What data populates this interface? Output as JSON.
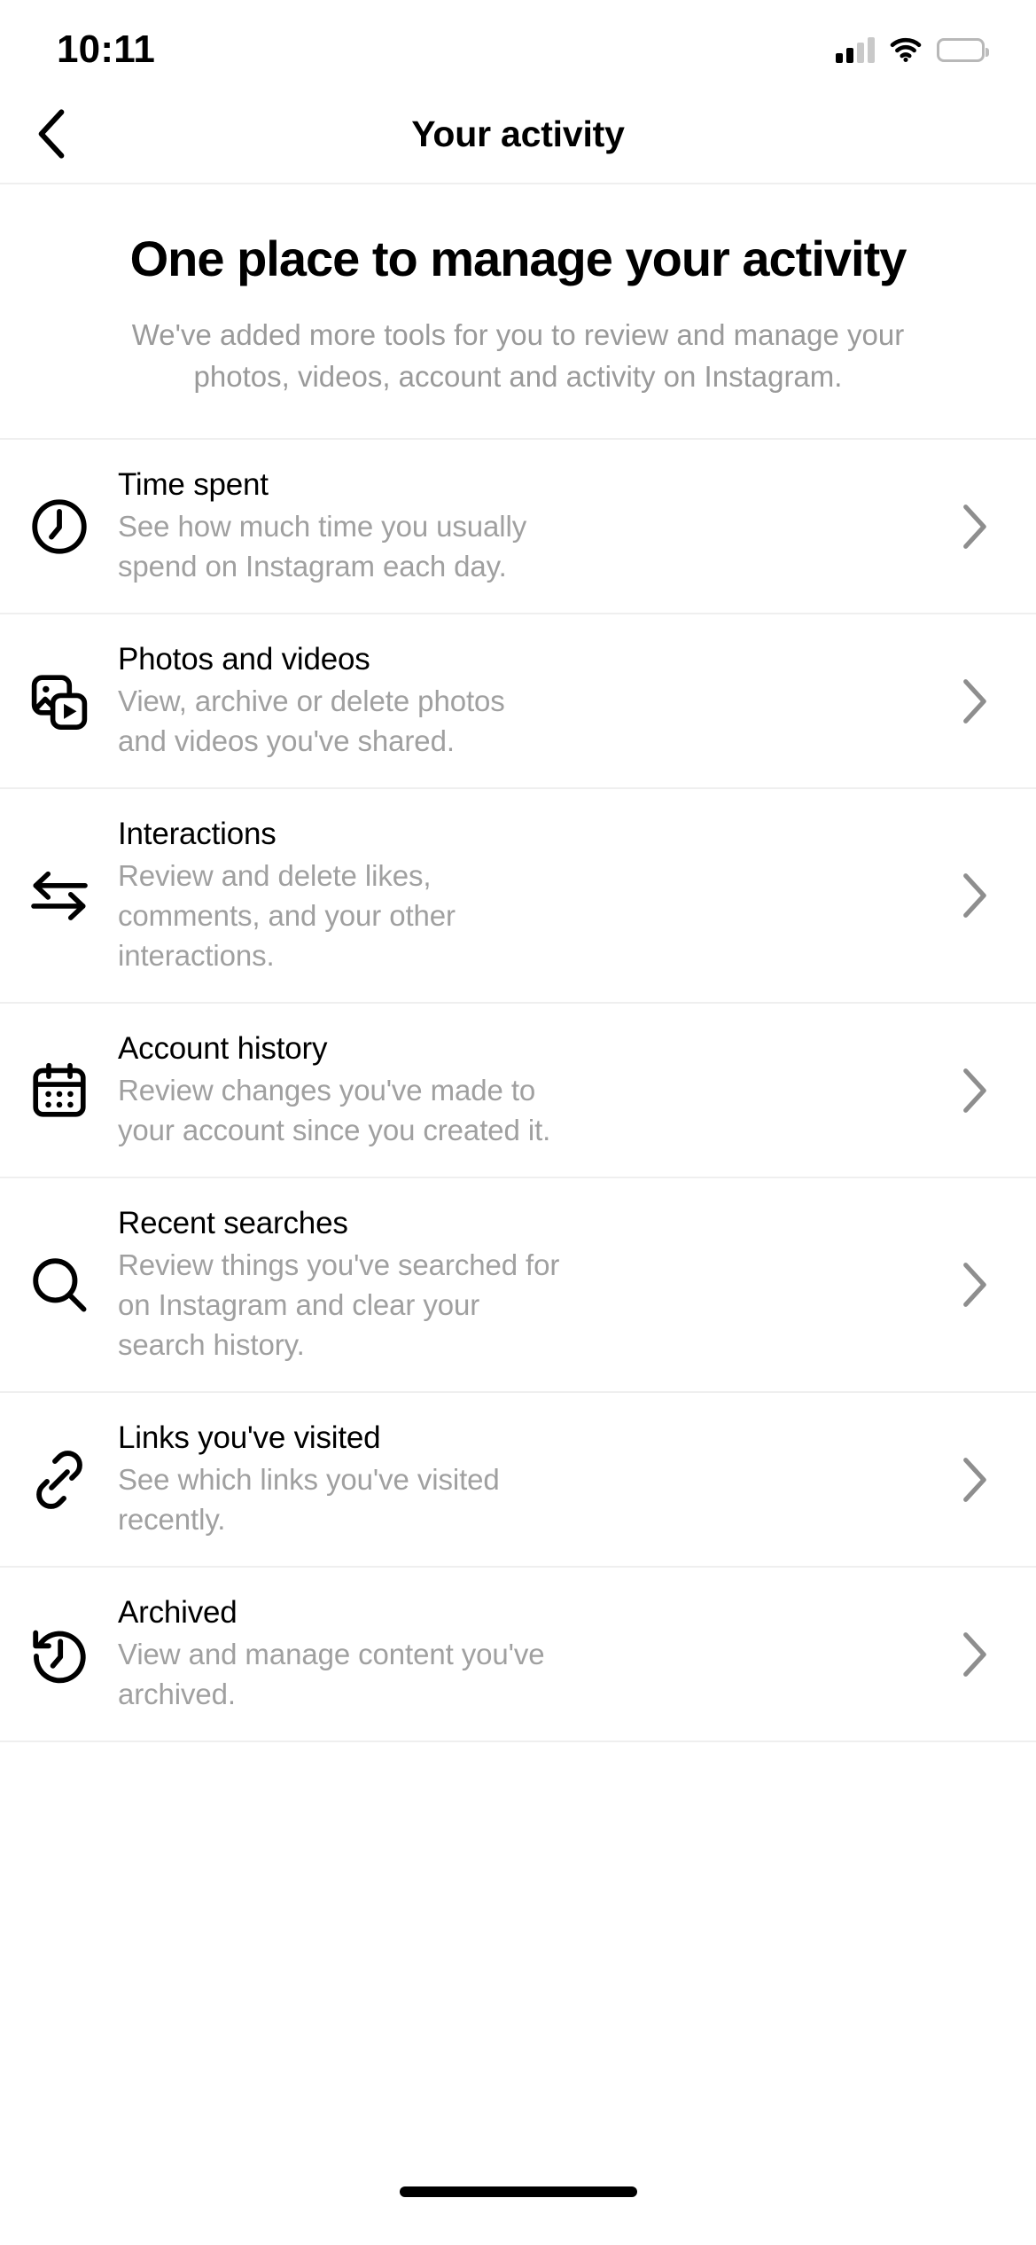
{
  "status_bar": {
    "time": "10:11",
    "cellular_icon": "cellular-signal-icon",
    "cellular_bars_filled": 2,
    "cellular_bars_total": 4,
    "wifi_icon": "wifi-icon",
    "battery_icon": "battery-full-icon"
  },
  "navbar": {
    "back_icon": "chevron-left-icon",
    "title": "Your activity"
  },
  "hero": {
    "title": "One place to manage your activity",
    "subtitle": "We've added more tools for you to review and manage your photos, videos, account and activity on Instagram."
  },
  "list": {
    "chevron_icon": "chevron-right-icon",
    "items": [
      {
        "icon": "clock-icon",
        "title": "Time spent",
        "description": "See how much time you usually spend on Instagram each day."
      },
      {
        "icon": "photos-videos-icon",
        "title": "Photos and videos",
        "description": "View, archive or delete photos and videos you've shared."
      },
      {
        "icon": "interactions-arrows-icon",
        "title": "Interactions",
        "description": "Review and delete likes, comments, and your other interactions."
      },
      {
        "icon": "calendar-icon",
        "title": "Account history",
        "description": "Review changes you've made to your account since you created it."
      },
      {
        "icon": "search-icon",
        "title": "Recent searches",
        "description": "Review things you've searched for on Instagram and clear your search history."
      },
      {
        "icon": "link-icon",
        "title": "Links you've visited",
        "description": "See which links you've visited recently."
      },
      {
        "icon": "history-clock-icon",
        "title": "Archived",
        "description": "View and manage content you've archived."
      }
    ]
  },
  "home_indicator": {
    "label": "home-indicator"
  },
  "colors": {
    "background": "#ffffff",
    "primary_text": "#000000",
    "secondary_text": "#a0a0a0",
    "divider": "#efefef"
  }
}
